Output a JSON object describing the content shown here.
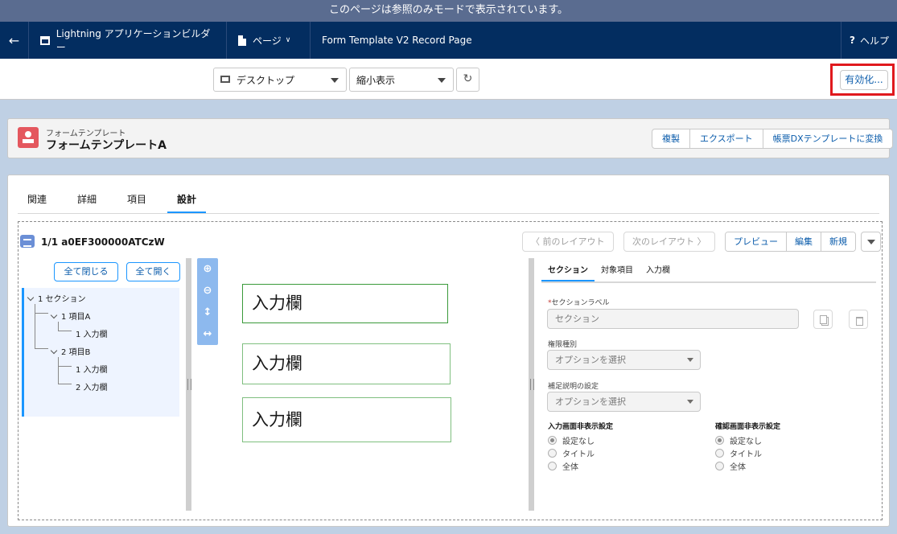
{
  "banner": {
    "text": "このページは参照のみモードで表示されています。"
  },
  "nav": {
    "app_name": "Lightning アプリケーションビルダー",
    "page_menu": "ページ",
    "page_title": "Form Template V2 Record Page",
    "help": "ヘルプ"
  },
  "toolbar": {
    "device_select": "デスクトップ",
    "view_select": "縮小表示",
    "activate": "有効化..."
  },
  "record": {
    "object_type": "フォームテンプレート",
    "name": "フォームテンプレートA",
    "actions": [
      "複製",
      "エクスポート",
      "帳票DXテンプレートに変換"
    ]
  },
  "tabs": [
    "関連",
    "詳細",
    "項目",
    "設計"
  ],
  "active_tab": "設計",
  "component": {
    "title": "1/1 a0EF300000ATCzW",
    "prev_layout": "前のレイアウト",
    "next_layout": "次のレイアウト",
    "actions": [
      "プレビュー",
      "編集",
      "新規"
    ]
  },
  "tree": {
    "collapse_all": "全て閉じる",
    "expand_all": "全て開く",
    "nodes": [
      "1 セクション",
      "1 項目A",
      "1 入力欄",
      "2 項目B",
      "1 入力欄",
      "2 入力欄"
    ]
  },
  "canvas_fields": [
    "入力欄",
    "入力欄",
    "入力欄"
  ],
  "props": {
    "tabs": [
      "セクション",
      "対象項目",
      "入力欄"
    ],
    "section_label_label": "セクションラベル",
    "section_label_value": "セクション",
    "permission_label": "権限種別",
    "permission_value": "オプションを選択",
    "supplement_label": "補足説明の設定",
    "supplement_value": "オプションを選択",
    "input_hide_title": "入力画面非表示設定",
    "confirm_hide_title": "確認画面非表示設定",
    "radio_options": [
      "設定なし",
      "タイトル",
      "全体"
    ],
    "selected_option": "設定なし"
  },
  "colors": {
    "nav_bg": "#032d60",
    "banner_bg": "#5a6c90",
    "brand_blue": "#1b96ff",
    "highlight_red": "#e0191d",
    "record_icon": "#e4575e"
  }
}
